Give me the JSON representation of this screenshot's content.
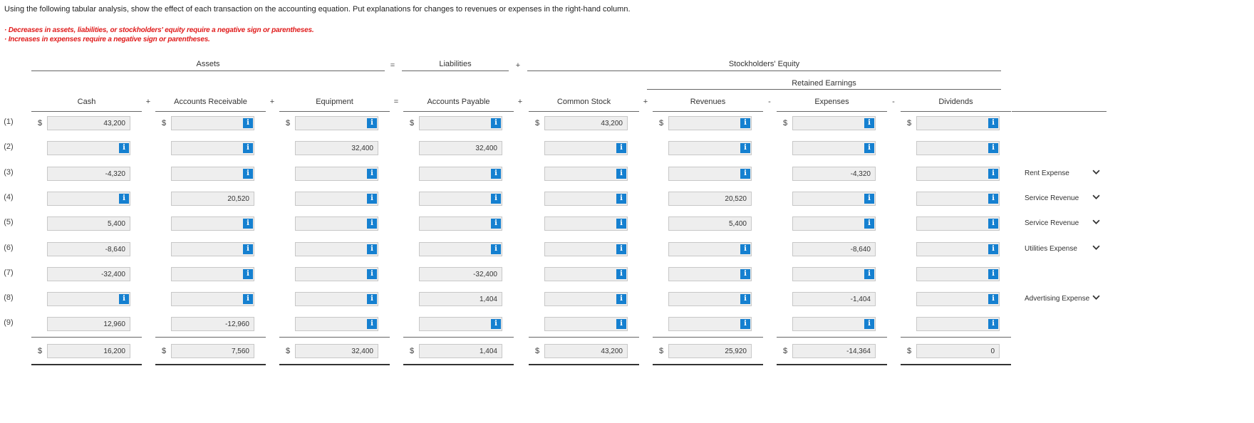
{
  "instruction": "Using the following tabular analysis, show the effect of each transaction on the accounting equation. Put explanations for changes to revenues or expenses in the right-hand column.",
  "notes": [
    "· Decreases in assets, liabilities, or stockholders' equity require a negative sign or parentheses.",
    "· Increases in expenses require a negative sign or parentheses."
  ],
  "groups": {
    "assets": "Assets",
    "liabilities": "Liabilities",
    "equity": "Stockholders' Equity",
    "retained": "Retained Earnings"
  },
  "group_ops": {
    "eq": "=",
    "plus": "+"
  },
  "columns": [
    {
      "name": "Cash",
      "op": "+"
    },
    {
      "name": "Accounts Receivable",
      "op": "+"
    },
    {
      "name": "Equipment",
      "op": "="
    },
    {
      "name": "Accounts Payable",
      "op": "+"
    },
    {
      "name": "Common Stock",
      "op": "+"
    },
    {
      "name": "Revenues",
      "op": "-"
    },
    {
      "name": "Expenses",
      "op": "-"
    },
    {
      "name": "Dividends",
      "op": ""
    }
  ],
  "info_label": "i",
  "currency": "$",
  "rows": [
    {
      "label": "(1)",
      "dollar": true,
      "values": [
        "43,200",
        "",
        "",
        "",
        "43,200",
        "",
        "",
        ""
      ],
      "info": [
        false,
        true,
        true,
        true,
        false,
        true,
        true,
        true
      ],
      "explanation": ""
    },
    {
      "label": "(2)",
      "dollar": false,
      "values": [
        "",
        "",
        "32,400",
        "32,400",
        "",
        "",
        "",
        ""
      ],
      "info": [
        true,
        true,
        false,
        false,
        true,
        true,
        true,
        true
      ],
      "explanation": ""
    },
    {
      "label": "(3)",
      "dollar": false,
      "values": [
        "-4,320",
        "",
        "",
        "",
        "",
        "",
        "-4,320",
        ""
      ],
      "info": [
        false,
        true,
        true,
        true,
        true,
        true,
        false,
        true
      ],
      "explanation": "Rent Expense"
    },
    {
      "label": "(4)",
      "dollar": false,
      "values": [
        "",
        "20,520",
        "",
        "",
        "",
        "20,520",
        "",
        ""
      ],
      "info": [
        true,
        false,
        true,
        true,
        true,
        false,
        true,
        true
      ],
      "explanation": "Service Revenue"
    },
    {
      "label": "(5)",
      "dollar": false,
      "values": [
        "5,400",
        "",
        "",
        "",
        "",
        "5,400",
        "",
        ""
      ],
      "info": [
        false,
        true,
        true,
        true,
        true,
        false,
        true,
        true
      ],
      "explanation": "Service Revenue"
    },
    {
      "label": "(6)",
      "dollar": false,
      "values": [
        "-8,640",
        "",
        "",
        "",
        "",
        "",
        "-8,640",
        ""
      ],
      "info": [
        false,
        true,
        true,
        true,
        true,
        true,
        false,
        true
      ],
      "explanation": "Utilities Expense"
    },
    {
      "label": "(7)",
      "dollar": false,
      "values": [
        "-32,400",
        "",
        "",
        "-32,400",
        "",
        "",
        "",
        ""
      ],
      "info": [
        false,
        true,
        true,
        false,
        true,
        true,
        true,
        true
      ],
      "explanation": ""
    },
    {
      "label": "(8)",
      "dollar": false,
      "values": [
        "",
        "",
        "",
        "1,404",
        "",
        "",
        "-1,404",
        ""
      ],
      "info": [
        true,
        true,
        true,
        false,
        true,
        true,
        false,
        true
      ],
      "explanation": "Advertising Expense"
    },
    {
      "label": "(9)",
      "dollar": false,
      "values": [
        "12,960",
        "-12,960",
        "",
        "",
        "",
        "",
        "",
        ""
      ],
      "info": [
        false,
        false,
        true,
        true,
        true,
        true,
        true,
        true
      ],
      "explanation": ""
    }
  ],
  "totals": [
    "16,200",
    "7,560",
    "32,400",
    "1,404",
    "43,200",
    "25,920",
    "-14,364",
    "0"
  ]
}
